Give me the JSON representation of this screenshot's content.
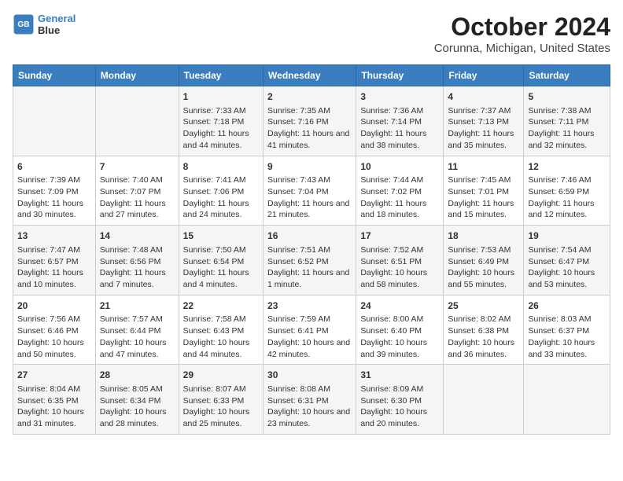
{
  "header": {
    "logo_line1": "General",
    "logo_line2": "Blue",
    "title": "October 2024",
    "subtitle": "Corunna, Michigan, United States"
  },
  "calendar": {
    "days_of_week": [
      "Sunday",
      "Monday",
      "Tuesday",
      "Wednesday",
      "Thursday",
      "Friday",
      "Saturday"
    ],
    "weeks": [
      [
        {
          "day": "",
          "info": ""
        },
        {
          "day": "",
          "info": ""
        },
        {
          "day": "1",
          "info": "Sunrise: 7:33 AM\nSunset: 7:18 PM\nDaylight: 11 hours and 44 minutes."
        },
        {
          "day": "2",
          "info": "Sunrise: 7:35 AM\nSunset: 7:16 PM\nDaylight: 11 hours and 41 minutes."
        },
        {
          "day": "3",
          "info": "Sunrise: 7:36 AM\nSunset: 7:14 PM\nDaylight: 11 hours and 38 minutes."
        },
        {
          "day": "4",
          "info": "Sunrise: 7:37 AM\nSunset: 7:13 PM\nDaylight: 11 hours and 35 minutes."
        },
        {
          "day": "5",
          "info": "Sunrise: 7:38 AM\nSunset: 7:11 PM\nDaylight: 11 hours and 32 minutes."
        }
      ],
      [
        {
          "day": "6",
          "info": "Sunrise: 7:39 AM\nSunset: 7:09 PM\nDaylight: 11 hours and 30 minutes."
        },
        {
          "day": "7",
          "info": "Sunrise: 7:40 AM\nSunset: 7:07 PM\nDaylight: 11 hours and 27 minutes."
        },
        {
          "day": "8",
          "info": "Sunrise: 7:41 AM\nSunset: 7:06 PM\nDaylight: 11 hours and 24 minutes."
        },
        {
          "day": "9",
          "info": "Sunrise: 7:43 AM\nSunset: 7:04 PM\nDaylight: 11 hours and 21 minutes."
        },
        {
          "day": "10",
          "info": "Sunrise: 7:44 AM\nSunset: 7:02 PM\nDaylight: 11 hours and 18 minutes."
        },
        {
          "day": "11",
          "info": "Sunrise: 7:45 AM\nSunset: 7:01 PM\nDaylight: 11 hours and 15 minutes."
        },
        {
          "day": "12",
          "info": "Sunrise: 7:46 AM\nSunset: 6:59 PM\nDaylight: 11 hours and 12 minutes."
        }
      ],
      [
        {
          "day": "13",
          "info": "Sunrise: 7:47 AM\nSunset: 6:57 PM\nDaylight: 11 hours and 10 minutes."
        },
        {
          "day": "14",
          "info": "Sunrise: 7:48 AM\nSunset: 6:56 PM\nDaylight: 11 hours and 7 minutes."
        },
        {
          "day": "15",
          "info": "Sunrise: 7:50 AM\nSunset: 6:54 PM\nDaylight: 11 hours and 4 minutes."
        },
        {
          "day": "16",
          "info": "Sunrise: 7:51 AM\nSunset: 6:52 PM\nDaylight: 11 hours and 1 minute."
        },
        {
          "day": "17",
          "info": "Sunrise: 7:52 AM\nSunset: 6:51 PM\nDaylight: 10 hours and 58 minutes."
        },
        {
          "day": "18",
          "info": "Sunrise: 7:53 AM\nSunset: 6:49 PM\nDaylight: 10 hours and 55 minutes."
        },
        {
          "day": "19",
          "info": "Sunrise: 7:54 AM\nSunset: 6:47 PM\nDaylight: 10 hours and 53 minutes."
        }
      ],
      [
        {
          "day": "20",
          "info": "Sunrise: 7:56 AM\nSunset: 6:46 PM\nDaylight: 10 hours and 50 minutes."
        },
        {
          "day": "21",
          "info": "Sunrise: 7:57 AM\nSunset: 6:44 PM\nDaylight: 10 hours and 47 minutes."
        },
        {
          "day": "22",
          "info": "Sunrise: 7:58 AM\nSunset: 6:43 PM\nDaylight: 10 hours and 44 minutes."
        },
        {
          "day": "23",
          "info": "Sunrise: 7:59 AM\nSunset: 6:41 PM\nDaylight: 10 hours and 42 minutes."
        },
        {
          "day": "24",
          "info": "Sunrise: 8:00 AM\nSunset: 6:40 PM\nDaylight: 10 hours and 39 minutes."
        },
        {
          "day": "25",
          "info": "Sunrise: 8:02 AM\nSunset: 6:38 PM\nDaylight: 10 hours and 36 minutes."
        },
        {
          "day": "26",
          "info": "Sunrise: 8:03 AM\nSunset: 6:37 PM\nDaylight: 10 hours and 33 minutes."
        }
      ],
      [
        {
          "day": "27",
          "info": "Sunrise: 8:04 AM\nSunset: 6:35 PM\nDaylight: 10 hours and 31 minutes."
        },
        {
          "day": "28",
          "info": "Sunrise: 8:05 AM\nSunset: 6:34 PM\nDaylight: 10 hours and 28 minutes."
        },
        {
          "day": "29",
          "info": "Sunrise: 8:07 AM\nSunset: 6:33 PM\nDaylight: 10 hours and 25 minutes."
        },
        {
          "day": "30",
          "info": "Sunrise: 8:08 AM\nSunset: 6:31 PM\nDaylight: 10 hours and 23 minutes."
        },
        {
          "day": "31",
          "info": "Sunrise: 8:09 AM\nSunset: 6:30 PM\nDaylight: 10 hours and 20 minutes."
        },
        {
          "day": "",
          "info": ""
        },
        {
          "day": "",
          "info": ""
        }
      ]
    ]
  }
}
